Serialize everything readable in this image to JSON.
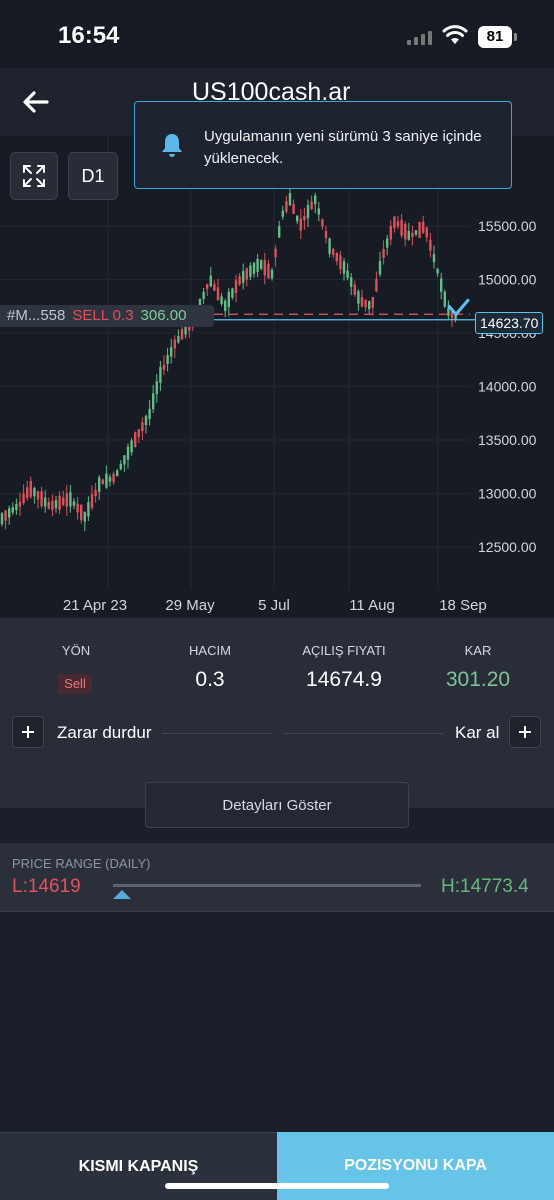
{
  "status": {
    "time": "16:54",
    "battery": "81"
  },
  "header": {
    "title": "US100cash.ar"
  },
  "toast": {
    "message": "Uygulamanın yeni sürümü 3 saniye içinde yüklenecek."
  },
  "chart": {
    "timeframe": "D1",
    "order_line": {
      "id": "#M...558",
      "side": "SELL 0.3",
      "profit": "306.00"
    },
    "current_price": "14623.70",
    "colors": {
      "up": "#5fbf85",
      "down": "#e0505a",
      "price_line": "#5cc0f0",
      "order_line": "#e25b62"
    }
  },
  "chart_data": {
    "type": "candlestick",
    "y_ticks": [
      "15500.00",
      "15000.00",
      "14500.00",
      "14000.00",
      "13500.00",
      "13000.00",
      "12500.00"
    ],
    "x_ticks": [
      "21 Apr 23",
      "29 May",
      "5 Jul",
      "11 Aug",
      "18 Sep"
    ],
    "ylim": [
      12250,
      16000
    ],
    "open_price": 14674.9,
    "current_price": 14623.7
  },
  "position": {
    "direction_label": "YÖN",
    "direction_value": "Sell",
    "volume_label": "HACIM",
    "volume_value": "0.3",
    "open_price_label": "AÇILIŞ FIYATI",
    "open_price_value": "14674.9",
    "profit_label": "KAR",
    "profit_value": "301.20",
    "stop_loss_label": "Zarar durdur",
    "take_profit_label": "Kar al",
    "details_button": "Detayları Göster"
  },
  "price_range": {
    "title": "PRICE RANGE (DAILY)",
    "low": "L:14619",
    "high": "H:14773.4",
    "low_value": 14619,
    "high_value": 14773.4,
    "current_value": 14623.7
  },
  "bottom": {
    "partial_close": "KISMI KAPANIŞ",
    "close_position": "POZISYONU KAPA"
  }
}
